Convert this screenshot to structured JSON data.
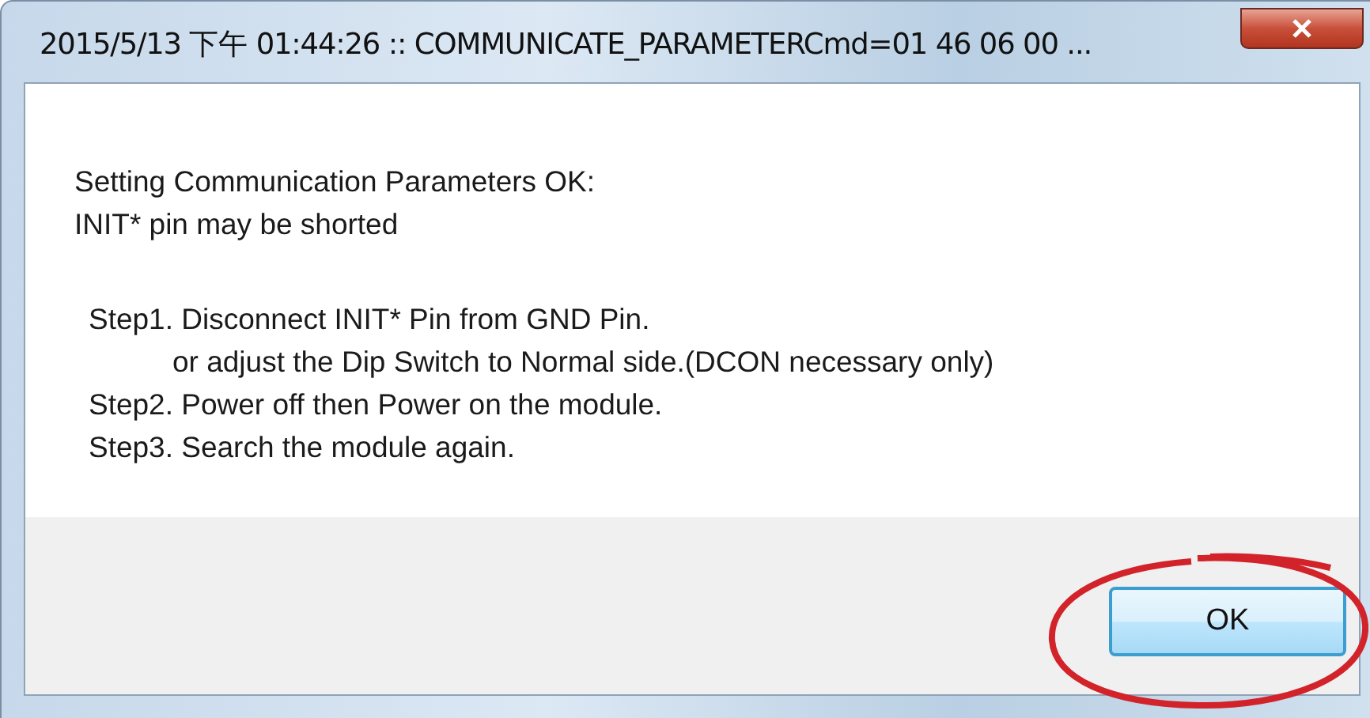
{
  "window": {
    "title": "2015/5/13 下午 01:44:26 :: COMMUNICATE_PARAMETERCmd=01 46 06 00 ..."
  },
  "message": {
    "header": [
      "Setting Communication Parameters OK:",
      "INIT* pin may be shorted"
    ],
    "steps": [
      {
        "kind": "step",
        "text": "Step1. Disconnect INIT* Pin from GND Pin."
      },
      {
        "kind": "continuation",
        "text": "or adjust the Dip Switch to Normal side.(DCON necessary only)"
      },
      {
        "kind": "step",
        "text": "Step2. Power off then Power on the module."
      },
      {
        "kind": "step",
        "text": "Step3. Search the module again."
      }
    ]
  },
  "button": {
    "label": "OK",
    "circled": true
  }
}
